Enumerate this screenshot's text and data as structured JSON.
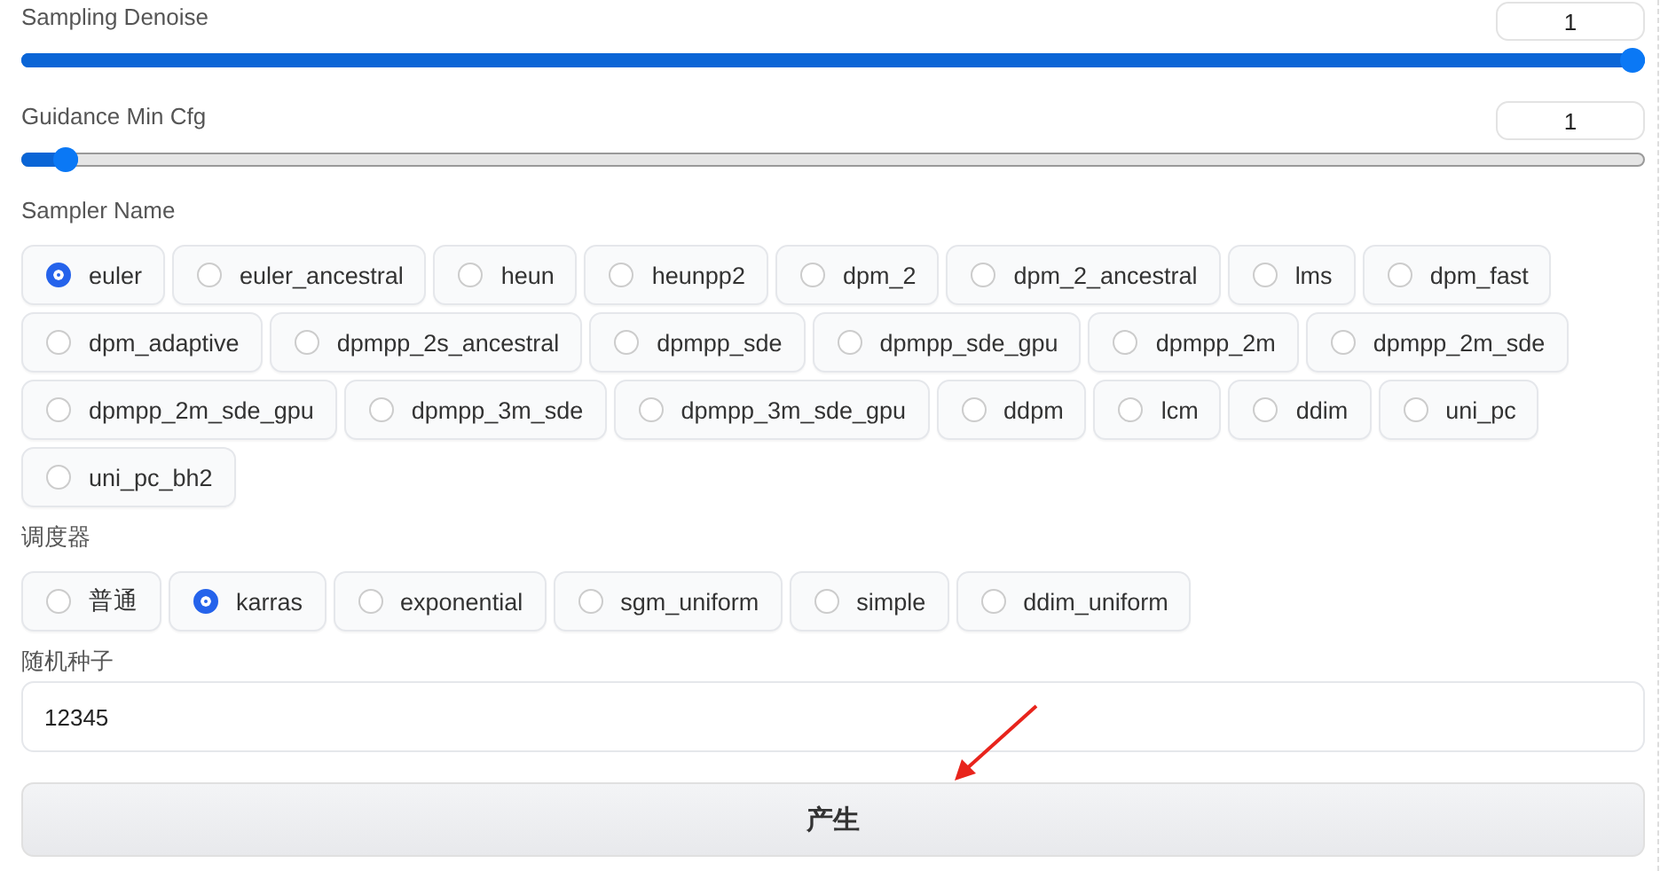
{
  "sliders": [
    {
      "label": "Sampling Denoise",
      "value": "1",
      "level": 1
    },
    {
      "label": "Guidance Min Cfg",
      "value": "1",
      "level": 0.02
    }
  ],
  "sampler": {
    "label": "Sampler Name",
    "options": [
      {
        "label": "euler",
        "selected": true
      },
      {
        "label": "euler_ancestral",
        "selected": false
      },
      {
        "label": "heun",
        "selected": false
      },
      {
        "label": "heunpp2",
        "selected": false
      },
      {
        "label": "dpm_2",
        "selected": false
      },
      {
        "label": "dpm_2_ancestral",
        "selected": false
      },
      {
        "label": "lms",
        "selected": false
      },
      {
        "label": "dpm_fast",
        "selected": false
      },
      {
        "label": "dpm_adaptive",
        "selected": false
      },
      {
        "label": "dpmpp_2s_ancestral",
        "selected": false
      },
      {
        "label": "dpmpp_sde",
        "selected": false
      },
      {
        "label": "dpmpp_sde_gpu",
        "selected": false
      },
      {
        "label": "dpmpp_2m",
        "selected": false
      },
      {
        "label": "dpmpp_2m_sde",
        "selected": false
      },
      {
        "label": "dpmpp_2m_sde_gpu",
        "selected": false
      },
      {
        "label": "dpmpp_3m_sde",
        "selected": false
      },
      {
        "label": "dpmpp_3m_sde_gpu",
        "selected": false
      },
      {
        "label": "ddpm",
        "selected": false
      },
      {
        "label": "lcm",
        "selected": false
      },
      {
        "label": "ddim",
        "selected": false
      },
      {
        "label": "uni_pc",
        "selected": false
      },
      {
        "label": "uni_pc_bh2",
        "selected": false
      }
    ]
  },
  "scheduler": {
    "label": "调度器",
    "options": [
      {
        "label": "普通",
        "selected": false
      },
      {
        "label": "karras",
        "selected": true
      },
      {
        "label": "exponential",
        "selected": false
      },
      {
        "label": "sgm_uniform",
        "selected": false
      },
      {
        "label": "simple",
        "selected": false
      },
      {
        "label": "ddim_uniform",
        "selected": false
      }
    ]
  },
  "seed": {
    "label": "随机种子",
    "value": "12345"
  },
  "generate_button": "产生"
}
